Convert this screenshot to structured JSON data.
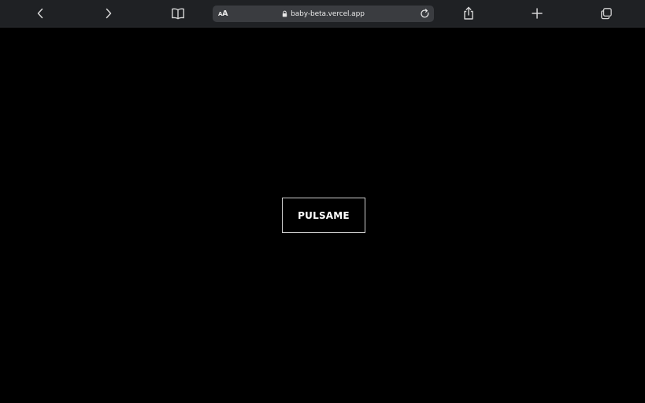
{
  "browser": {
    "reader_label_big": "A",
    "reader_label_small": "A",
    "url": "baby-beta.vercel.app",
    "icons": {
      "back": "chevron-left-icon",
      "forward": "chevron-right-icon",
      "bookmarks": "book-icon",
      "lock": "lock-icon",
      "reload": "reload-icon",
      "share": "share-icon",
      "new_tab": "plus-icon",
      "tabs": "tabs-icon"
    },
    "colors": {
      "toolbar_bg": "#1f2124",
      "address_bg": "#3a3c40",
      "icon": "#d6d6d6"
    }
  },
  "page": {
    "button_label": "PULSAME",
    "colors": {
      "background": "#000000",
      "button_border": "#cfcfcf",
      "button_text": "#ffffff"
    }
  }
}
